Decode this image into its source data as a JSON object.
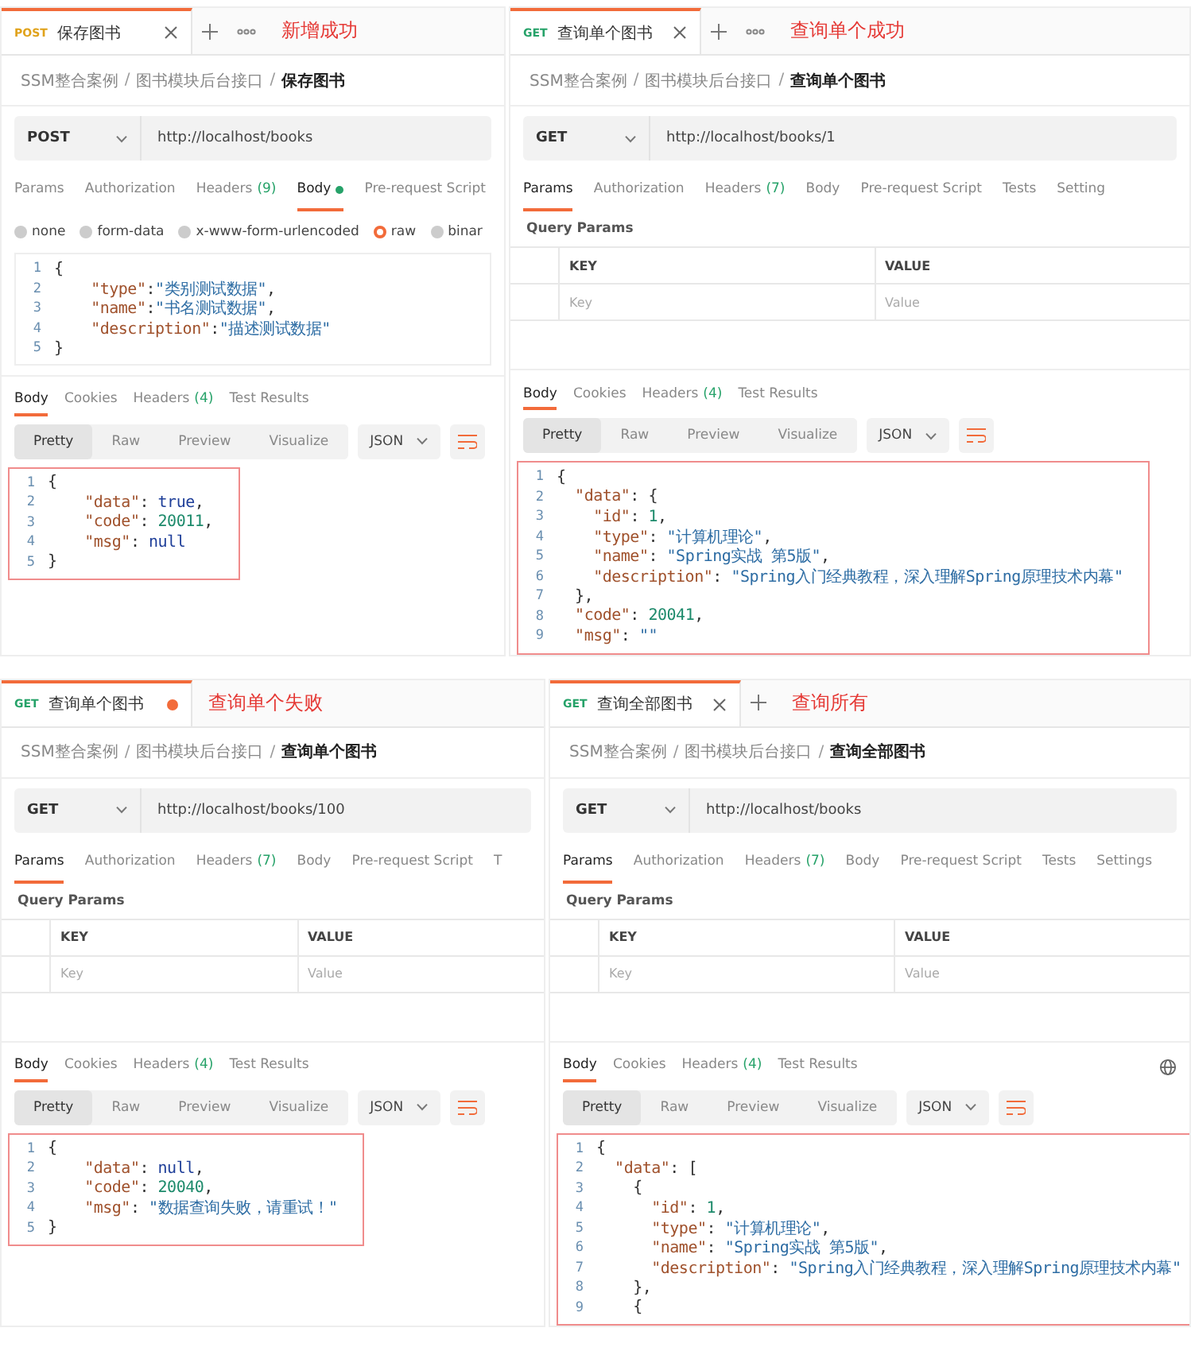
{
  "panels": [
    {
      "tab": {
        "method": "POST",
        "title": "保存图书",
        "unsaved": false,
        "selected": true
      },
      "breadcrumb_separator": "/",
      "new_tab": true,
      "more_menu": true,
      "annotation": "新增成功",
      "breadcrumb": [
        "SSM整合案例",
        "图书模块后台接口",
        "保存图书"
      ],
      "request": {
        "method": "POST",
        "url": "http://localhost/books"
      },
      "request_tabs": [
        {
          "label": "Params",
          "selected": false,
          "modified": false
        },
        {
          "label": "Authorization",
          "selected": false,
          "modified": false
        },
        {
          "label": "Headers",
          "count": "(9)",
          "selected": false,
          "modified": false
        },
        {
          "label": "Body",
          "selected": true,
          "modified": true
        },
        {
          "label": "Pre-request Script",
          "selected": false,
          "modified": false
        }
      ],
      "request_section": {
        "kind": "body",
        "options": [
          {
            "label": "none",
            "selected": false
          },
          {
            "label": "form-data",
            "selected": false
          },
          {
            "label": "x-www-form-urlencoded",
            "selected": false
          },
          {
            "label": "raw",
            "selected": true
          },
          {
            "label": "binar",
            "selected": false
          }
        ],
        "lines": [
          {
            "n": "1",
            "code": "{"
          },
          {
            "n": "2",
            "code": "    \"type\":\"类别测试数据\","
          },
          {
            "n": "3",
            "code": "    \"name\":\"书名测试数据\","
          },
          {
            "n": "4",
            "code": "    \"description\":\"描述测试数据\""
          },
          {
            "n": "5",
            "code": "}"
          }
        ]
      },
      "response": {
        "tabs": [
          {
            "label": "Body",
            "selected": true
          },
          {
            "label": "Cookies",
            "selected": false
          },
          {
            "label": "Headers",
            "count": "(4)",
            "selected": false
          },
          {
            "label": "Test Results",
            "selected": false
          }
        ],
        "globe": false,
        "views": [
          {
            "label": "Pretty",
            "selected": true
          },
          {
            "label": "Raw",
            "selected": false
          },
          {
            "label": "Preview",
            "selected": false
          },
          {
            "label": "Visualize",
            "selected": false
          }
        ],
        "format": "JSON",
        "lines": [
          {
            "n": "1",
            "code": "{"
          },
          {
            "n": "2",
            "code": "    \"data\": true,"
          },
          {
            "n": "3",
            "code": "    \"code\": 20011,"
          },
          {
            "n": "4",
            "code": "    \"msg\": null"
          },
          {
            "n": "5",
            "code": "}"
          }
        ]
      }
    },
    {
      "tab": {
        "method": "GET",
        "title": "查询单个图书",
        "unsaved": false,
        "selected": true
      },
      "breadcrumb_separator": "/",
      "new_tab": true,
      "more_menu": true,
      "annotation": "查询单个成功",
      "breadcrumb": [
        "SSM整合案例",
        "图书模块后台接口",
        "查询单个图书"
      ],
      "request": {
        "method": "GET",
        "url": "http://localhost/books/1"
      },
      "request_tabs": [
        {
          "label": "Params",
          "selected": true
        },
        {
          "label": "Authorization",
          "selected": false
        },
        {
          "label": "Headers",
          "count": "(7)",
          "selected": false
        },
        {
          "label": "Body",
          "selected": false
        },
        {
          "label": "Pre-request Script",
          "selected": false
        },
        {
          "label": "Tests",
          "selected": false
        },
        {
          "label": "Setting",
          "selected": false
        }
      ],
      "request_section": {
        "kind": "params",
        "title": "Query Params",
        "columns": [
          "KEY",
          "VALUE"
        ],
        "placeholders": [
          "Key",
          "Value"
        ]
      },
      "response": {
        "tabs": [
          {
            "label": "Body",
            "selected": true
          },
          {
            "label": "Cookies",
            "selected": false
          },
          {
            "label": "Headers",
            "count": "(4)",
            "selected": false
          },
          {
            "label": "Test Results",
            "selected": false
          }
        ],
        "globe": false,
        "views": [
          {
            "label": "Pretty",
            "selected": true
          },
          {
            "label": "Raw",
            "selected": false
          },
          {
            "label": "Preview",
            "selected": false
          },
          {
            "label": "Visualize",
            "selected": false
          }
        ],
        "format": "JSON",
        "lines": [
          {
            "n": "1",
            "code": "{"
          },
          {
            "n": "2",
            "code": "  \"data\": {"
          },
          {
            "n": "3",
            "code": "    \"id\": 1,"
          },
          {
            "n": "4",
            "code": "    \"type\": \"计算机理论\","
          },
          {
            "n": "5",
            "code": "    \"name\": \"Spring实战 第5版\","
          },
          {
            "n": "6",
            "code": "    \"description\": \"Spring入门经典教程，深入理解Spring原理技术内幕\""
          },
          {
            "n": "7",
            "code": "  },"
          },
          {
            "n": "8",
            "code": "  \"code\": 20041,"
          },
          {
            "n": "9",
            "code": "  \"msg\": \"\""
          }
        ]
      }
    },
    {
      "tab": {
        "method": "GET",
        "title": "查询单个图书",
        "unsaved": true,
        "selected": true
      },
      "breadcrumb_separator": "/",
      "new_tab": false,
      "more_menu": false,
      "annotation": "查询单个失败",
      "breadcrumb": [
        "SSM整合案例",
        "图书模块后台接口",
        "查询单个图书"
      ],
      "request": {
        "method": "GET",
        "url": "http://localhost/books/100"
      },
      "request_tabs": [
        {
          "label": "Params",
          "selected": true
        },
        {
          "label": "Authorization",
          "selected": false
        },
        {
          "label": "Headers",
          "count": "(7)",
          "selected": false
        },
        {
          "label": "Body",
          "selected": false
        },
        {
          "label": "Pre-request Script",
          "selected": false
        },
        {
          "label": "T",
          "selected": false
        }
      ],
      "request_section": {
        "kind": "params",
        "title": "Query Params",
        "columns": [
          "KEY",
          "VALUE"
        ],
        "placeholders": [
          "Key",
          "Value"
        ]
      },
      "response": {
        "tabs": [
          {
            "label": "Body",
            "selected": true
          },
          {
            "label": "Cookies",
            "selected": false
          },
          {
            "label": "Headers",
            "count": "(4)",
            "selected": false
          },
          {
            "label": "Test Results",
            "selected": false
          }
        ],
        "globe": false,
        "views": [
          {
            "label": "Pretty",
            "selected": true
          },
          {
            "label": "Raw",
            "selected": false
          },
          {
            "label": "Preview",
            "selected": false
          },
          {
            "label": "Visualize",
            "selected": false
          }
        ],
        "format": "JSON",
        "lines": [
          {
            "n": "1",
            "code": "{"
          },
          {
            "n": "2",
            "code": "    \"data\": null,"
          },
          {
            "n": "3",
            "code": "    \"code\": 20040,"
          },
          {
            "n": "4",
            "code": "    \"msg\": \"数据查询失败，请重试！\""
          },
          {
            "n": "5",
            "code": "}"
          }
        ]
      }
    },
    {
      "tab": {
        "method": "GET",
        "title": "查询全部图书",
        "unsaved": false,
        "selected": true
      },
      "breadcrumb_separator": "/",
      "new_tab": true,
      "more_menu": false,
      "annotation": "查询所有",
      "breadcrumb": [
        "SSM整合案例",
        "图书模块后台接口",
        "查询全部图书"
      ],
      "request": {
        "method": "GET",
        "url": "http://localhost/books"
      },
      "request_tabs": [
        {
          "label": "Params",
          "selected": true
        },
        {
          "label": "Authorization",
          "selected": false
        },
        {
          "label": "Headers",
          "count": "(7)",
          "selected": false
        },
        {
          "label": "Body",
          "selected": false
        },
        {
          "label": "Pre-request Script",
          "selected": false
        },
        {
          "label": "Tests",
          "selected": false
        },
        {
          "label": "Settings",
          "selected": false
        }
      ],
      "request_section": {
        "kind": "params",
        "title": "Query Params",
        "columns": [
          "KEY",
          "VALUE"
        ],
        "placeholders": [
          "Key",
          "Value"
        ]
      },
      "response": {
        "tabs": [
          {
            "label": "Body",
            "selected": true
          },
          {
            "label": "Cookies",
            "selected": false
          },
          {
            "label": "Headers",
            "count": "(4)",
            "selected": false
          },
          {
            "label": "Test Results",
            "selected": false
          }
        ],
        "globe": true,
        "views": [
          {
            "label": "Pretty",
            "selected": true
          },
          {
            "label": "Raw",
            "selected": false
          },
          {
            "label": "Preview",
            "selected": false
          },
          {
            "label": "Visualize",
            "selected": false
          }
        ],
        "format": "JSON",
        "lines": [
          {
            "n": "1",
            "code": "{"
          },
          {
            "n": "2",
            "code": "  \"data\": ["
          },
          {
            "n": "3",
            "code": "    {"
          },
          {
            "n": "4",
            "code": "      \"id\": 1,"
          },
          {
            "n": "5",
            "code": "      \"type\": \"计算机理论\","
          },
          {
            "n": "6",
            "code": "      \"name\": \"Spring实战 第5版\","
          },
          {
            "n": "7",
            "code": "      \"description\": \"Spring入门经典教程，深入理解Spring原理技术内幕\""
          },
          {
            "n": "8",
            "code": "    },"
          },
          {
            "n": "9",
            "code": "    {"
          }
        ]
      }
    }
  ]
}
